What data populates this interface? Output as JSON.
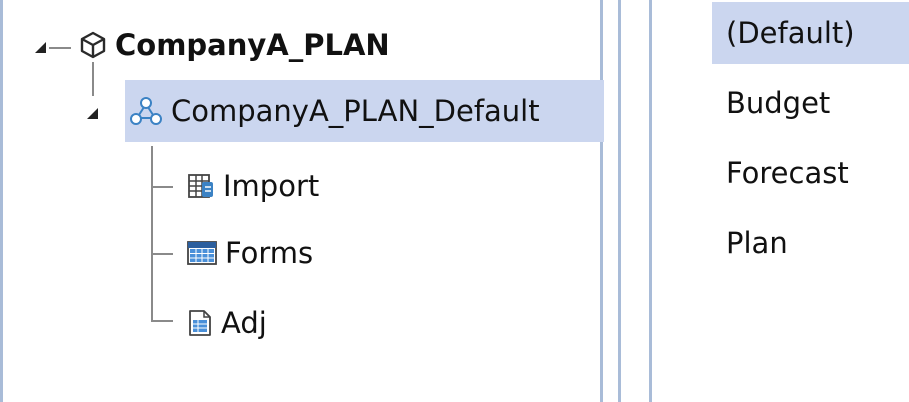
{
  "tree": {
    "root": {
      "label": "CompanyA_PLAN",
      "icon": "cube-icon"
    },
    "model": {
      "label": "CompanyA_PLAN_Default",
      "icon": "network-nodes-icon"
    },
    "children": [
      {
        "label": "Import",
        "icon": "import-table-icon"
      },
      {
        "label": "Forms",
        "icon": "forms-grid-icon"
      },
      {
        "label": "Adj",
        "icon": "document-icon"
      }
    ]
  },
  "list": {
    "items": [
      {
        "label": "(Default)",
        "selected": true
      },
      {
        "label": "Budget",
        "selected": false
      },
      {
        "label": "Forecast",
        "selected": false
      },
      {
        "label": "Plan",
        "selected": false
      }
    ]
  },
  "colors": {
    "selection": "#cbd6ef",
    "border": "#a9bcd8",
    "icon_blue": "#3b82c4"
  }
}
